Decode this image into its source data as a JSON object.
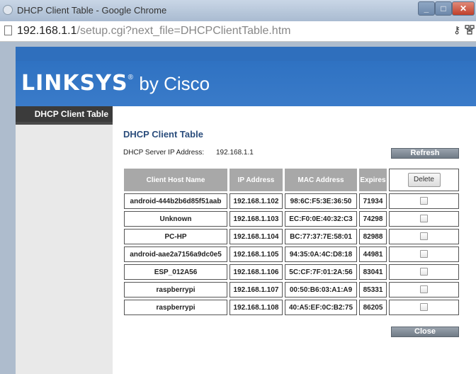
{
  "window": {
    "title": "DHCP Client Table - Google Chrome"
  },
  "window_controls": {
    "minimize": "_",
    "maximize": "□",
    "close": "✕"
  },
  "address_bar": {
    "host": "192.168.1.1",
    "path": "/setup.cgi?next_file=DHCPClientTable.htm"
  },
  "icons": [
    "chrome-app-icon",
    "page-icon",
    "key-icon",
    "network-icon"
  ],
  "brand": {
    "name": "LINKSYS",
    "reg": "®",
    "by": "by Cisco"
  },
  "colors": {
    "band": "#2f6fbd",
    "header_cell": "#a8a8a8",
    "sidebar_active": "#3b3b3b",
    "title": "#2b4d7c"
  },
  "sidebar": {
    "items": [
      {
        "label": "DHCP Client Table",
        "active": true
      }
    ]
  },
  "page": {
    "title": "DHCP Client Table",
    "server_label": "DHCP Server IP Address:",
    "server_ip": "192.168.1.1",
    "refresh_label": "Refresh",
    "close_label": "Close"
  },
  "table": {
    "columns": [
      "Client Host Name",
      "IP Address",
      "MAC Address",
      "Expires"
    ],
    "delete_label": "Delete",
    "rows": [
      [
        "android-444b2b6d85f51aab",
        "192.168.1.102",
        "98:6C:F5:3E:36:50",
        "71934"
      ],
      [
        "Unknown",
        "192.168.1.103",
        "EC:F0:0E:40:32:C3",
        "74298"
      ],
      [
        "PC-HP",
        "192.168.1.104",
        "BC:77:37:7E:58:01",
        "82988"
      ],
      [
        "android-aae2a7156a9dc0e5",
        "192.168.1.105",
        "94:35:0A:4C:D8:18",
        "44981"
      ],
      [
        "ESP_012A56",
        "192.168.1.106",
        "5C:CF:7F:01:2A:56",
        "83041"
      ],
      [
        "raspberrypi",
        "192.168.1.107",
        "00:50:B6:03:A1:A9",
        "85331"
      ],
      [
        "raspberrypi",
        "192.168.1.108",
        "40:A5:EF:0C:B2:75",
        "86205"
      ]
    ]
  }
}
